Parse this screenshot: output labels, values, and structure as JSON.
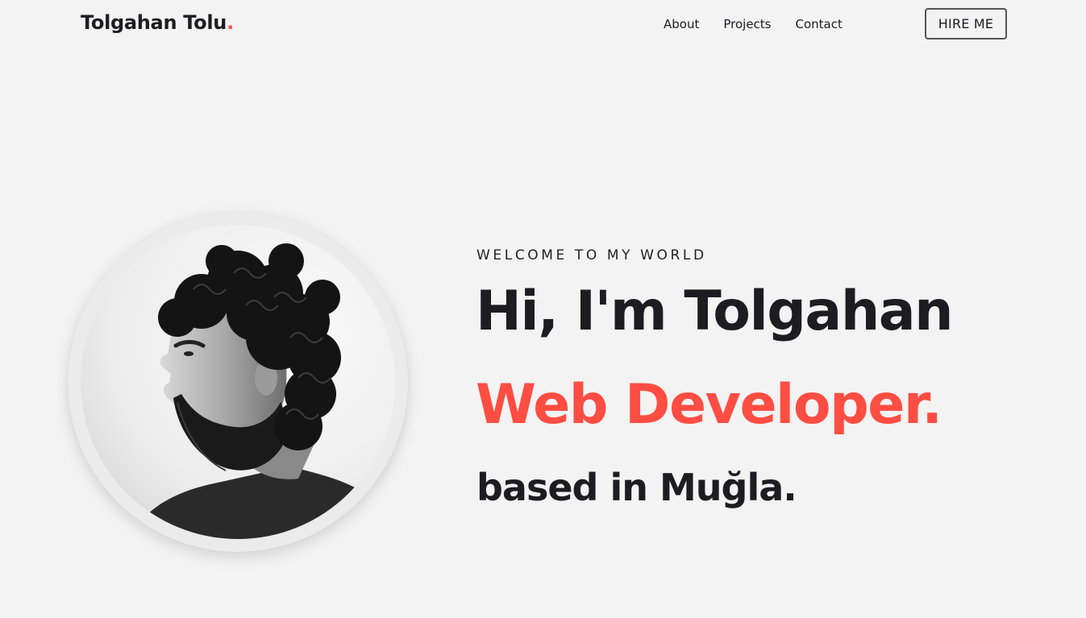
{
  "header": {
    "logo_name": "Tolgahan Tolu",
    "logo_dot": ".",
    "nav": [
      {
        "label": "About"
      },
      {
        "label": "Projects"
      },
      {
        "label": "Contact"
      }
    ],
    "hire_label": "HIRE ME"
  },
  "hero": {
    "eyebrow": "WELCOME TO MY WORLD",
    "headline": "Hi, I'm Tolgahan",
    "role": "Web Developer.",
    "location": "based in Muğla."
  },
  "colors": {
    "background": "#f3f3f3",
    "text": "#1c1c21",
    "accent": "#fe4d42"
  }
}
